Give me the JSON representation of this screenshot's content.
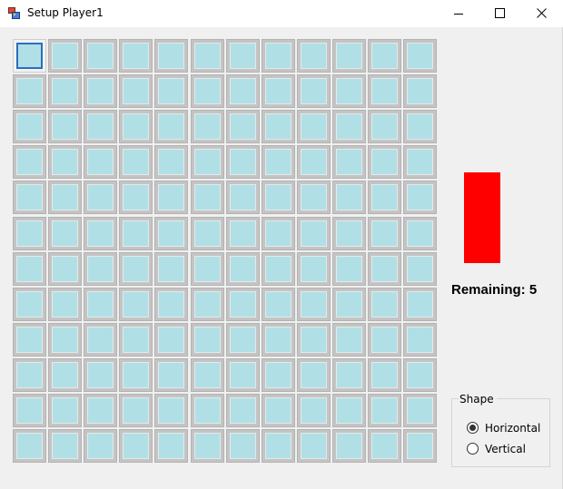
{
  "window": {
    "title": "Setup Player1"
  },
  "board": {
    "rows": 12,
    "cols": 12,
    "selected_cell": [
      0,
      0
    ]
  },
  "ship_preview": {
    "color": "#ff0000",
    "orientation": "vertical"
  },
  "remaining": {
    "label": "Remaining:",
    "count": "5"
  },
  "shape_group": {
    "title": "Shape",
    "options": [
      {
        "label": "Horizontal",
        "checked": true
      },
      {
        "label": "Vertical",
        "checked": false
      }
    ]
  },
  "colors": {
    "cell_fill": "#b0e0e6",
    "cell_frame": "#c4c4c4",
    "selection": "#2a6fbf",
    "ship": "#ff0000"
  }
}
